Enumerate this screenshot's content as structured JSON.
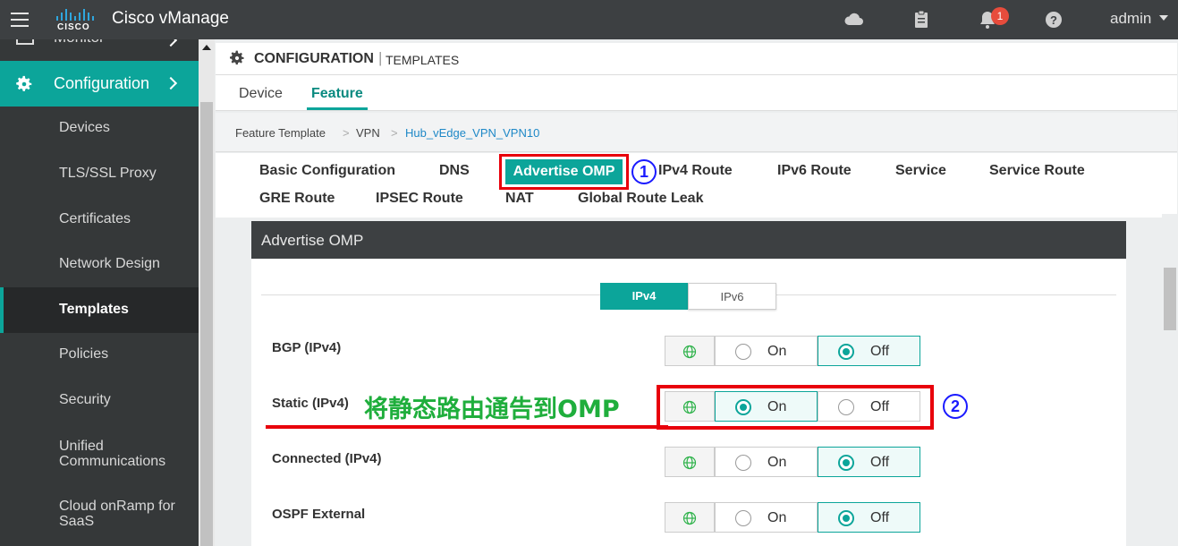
{
  "app": {
    "brand": "Cisco vManage",
    "logo_text": "CISCO",
    "notification_count": "1",
    "user": "admin"
  },
  "sidebar": {
    "monitor_label": "Monitor",
    "config_label": "Configuration",
    "items": [
      {
        "label": "Devices"
      },
      {
        "label": "TLS/SSL Proxy"
      },
      {
        "label": "Certificates"
      },
      {
        "label": "Network Design"
      },
      {
        "label": "Templates"
      },
      {
        "label": "Policies"
      },
      {
        "label": "Security"
      },
      {
        "label": "Unified Communications"
      },
      {
        "label": "Cloud onRamp for SaaS"
      }
    ]
  },
  "header": {
    "title": "CONFIGURATION",
    "separator": "|",
    "subtitle": "TEMPLATES"
  },
  "tabs": [
    {
      "label": "Device"
    },
    {
      "label": "Feature"
    }
  ],
  "breadcrumb": {
    "items": [
      "Feature Template",
      "VPN",
      "Hub_vEdge_VPN_VPN10"
    ],
    "separator": ">"
  },
  "section_tabs": {
    "row1": [
      "Basic Configuration",
      "DNS",
      "Advertise OMP",
      "IPv4 Route",
      "IPv6 Route",
      "Service",
      "Service Route"
    ],
    "row2": [
      "GRE Route",
      "IPSEC Route",
      "NAT",
      "Global Route Leak"
    ]
  },
  "annotations": {
    "marker1": "1",
    "marker2": "2",
    "note": "将静态路由通告到OMP"
  },
  "panel": {
    "title": "Advertise OMP",
    "ip_toggle": [
      "IPv4",
      "IPv6"
    ],
    "rows": [
      {
        "label": "BGP (IPv4)",
        "on": "On",
        "off": "Off"
      },
      {
        "label": "Static (IPv4)",
        "on": "On",
        "off": "Off"
      },
      {
        "label": "Connected (IPv4)",
        "on": "On",
        "off": "Off"
      },
      {
        "label": "OSPF External",
        "on": "On",
        "off": "Off"
      }
    ]
  },
  "colors": {
    "accent": "#0ca59a",
    "topbar": "#3d4042",
    "sidebar": "#353839",
    "annotation_red": "#e8000b",
    "annotation_green": "#1fae3c",
    "annotation_blue": "#1a1aff"
  },
  "icons": [
    "hamburger-icon",
    "cisco-logo",
    "cloud-icon",
    "clipboard-icon",
    "bell-icon",
    "help-icon",
    "caret-down-icon",
    "monitor-icon",
    "gear-icon",
    "chevron-right-icon",
    "globe-icon"
  ]
}
